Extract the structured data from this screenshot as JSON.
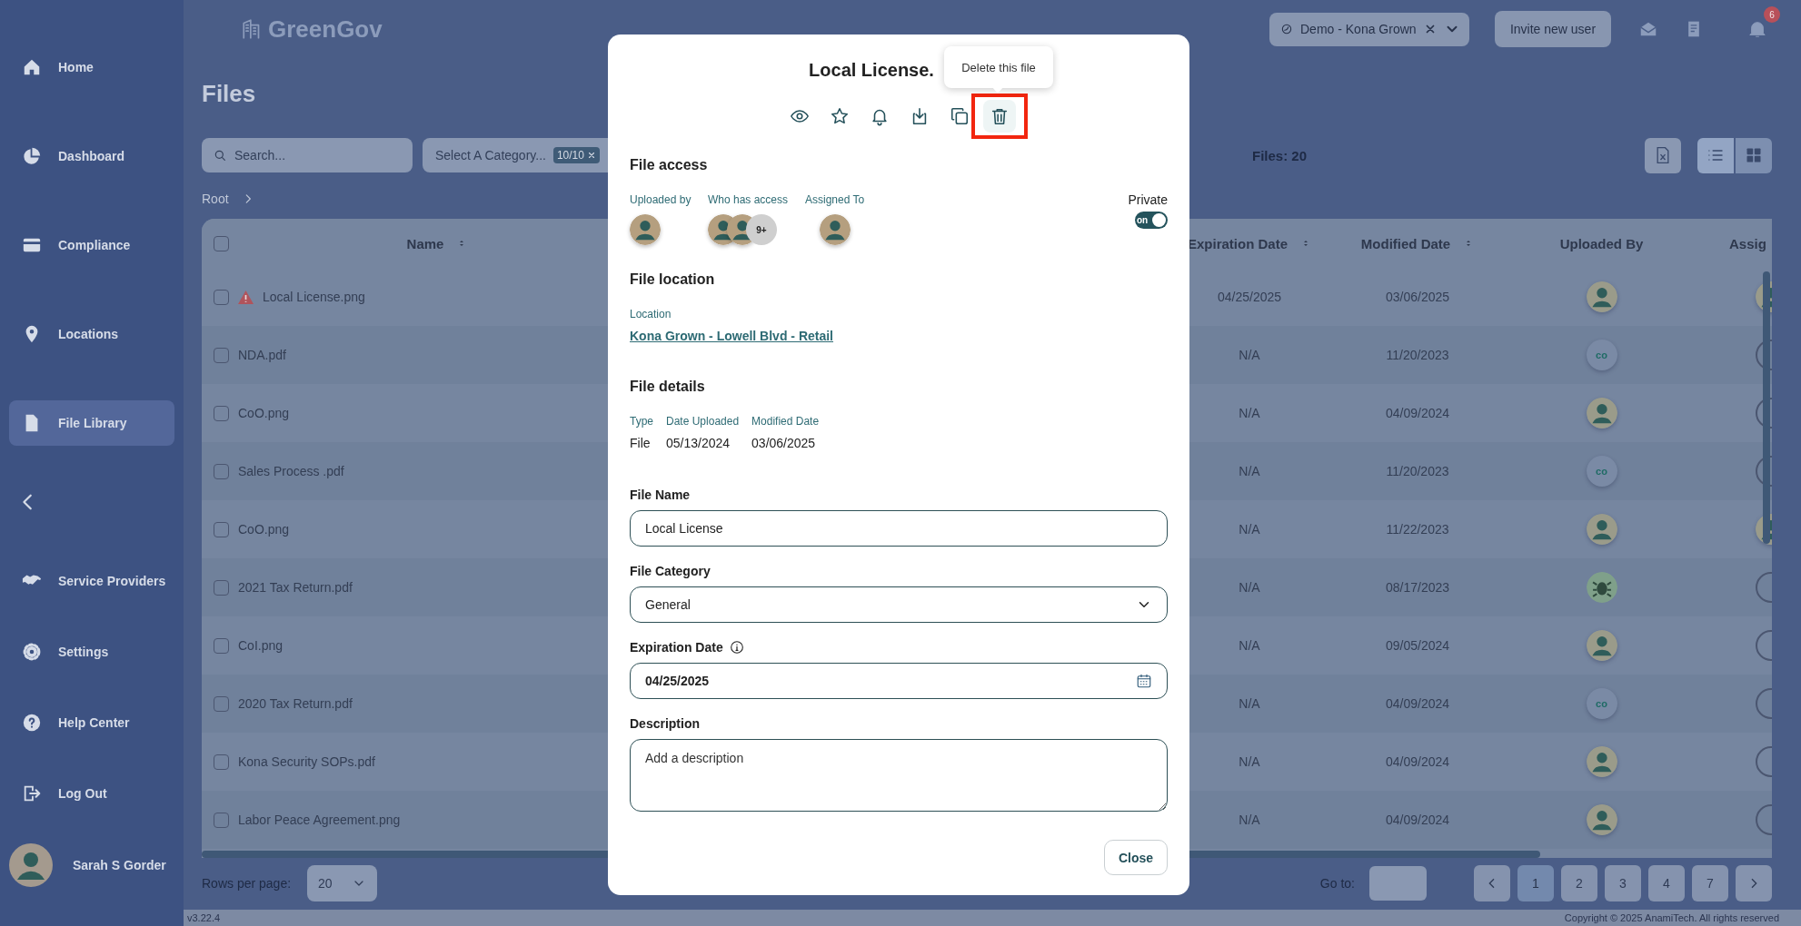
{
  "sidebar": {
    "items": [
      {
        "kind": "home",
        "label": "Home",
        "selected": false
      },
      {
        "kind": "dashboard",
        "label": "Dashboard",
        "selected": false
      },
      {
        "kind": "compliance",
        "label": "Compliance",
        "selected": false
      },
      {
        "kind": "locations",
        "label": "Locations",
        "selected": false
      },
      {
        "kind": "files",
        "label": "File Library",
        "selected": true
      }
    ],
    "bottom_items": [
      {
        "kind": "service",
        "label": "Service Providers",
        "selected": false
      },
      {
        "kind": "settings",
        "label": "Settings",
        "selected": false
      },
      {
        "kind": "help",
        "label": "Help Center",
        "selected": false
      },
      {
        "kind": "logout",
        "label": "Log Out",
        "selected": false
      }
    ],
    "user": {
      "name": "Sarah S Gorder"
    }
  },
  "topbar": {
    "logo": "GreenGov",
    "account": "Demo - Kona Grown",
    "invite_button": "Invite new user",
    "notification_badge": "6"
  },
  "page": {
    "title": "Files",
    "search": {
      "placeholder": "Search..."
    },
    "category_filter": {
      "placeholder": "Select A Category...",
      "chip": "10/10"
    },
    "file_count": "Files: 20",
    "views": [
      {
        "kind": "list",
        "selected": true
      },
      {
        "kind": "grid",
        "selected": false
      }
    ],
    "breadcrumb": [
      "Root"
    ]
  },
  "table": {
    "select_all": {
      "checked": false
    },
    "columns": [
      {
        "label": "Name",
        "sortable": true
      },
      {
        "label": "Expiration Date",
        "sortable": true
      },
      {
        "label": "Modified Date",
        "sortable": true
      },
      {
        "label": "Uploaded By",
        "sortable": false
      },
      {
        "label": "Assig",
        "sortable": false
      }
    ],
    "rows": [
      {
        "checked": false,
        "warning": true,
        "name": "Local License.png",
        "expiration": "04/25/2025",
        "modified": "03/06/2025",
        "uploaded_by": {
          "kind": "photo"
        },
        "assigned": {
          "kind": "photo"
        }
      },
      {
        "checked": false,
        "warning": false,
        "name": "NDA.pdf",
        "expiration": "N/A",
        "modified": "11/20/2023",
        "uploaded_by": {
          "kind": "initials",
          "text": "co"
        },
        "assigned": {
          "kind": "empty"
        }
      },
      {
        "checked": false,
        "warning": false,
        "name": "CoO.png",
        "expiration": "N/A",
        "modified": "04/09/2024",
        "uploaded_by": {
          "kind": "photo"
        },
        "assigned": {
          "kind": "empty"
        }
      },
      {
        "checked": false,
        "warning": false,
        "name": "Sales Process .pdf",
        "expiration": "N/A",
        "modified": "11/20/2023",
        "uploaded_by": {
          "kind": "initials",
          "text": "co"
        },
        "assigned": {
          "kind": "empty"
        }
      },
      {
        "checked": false,
        "warning": false,
        "name": "CoO.png",
        "expiration": "N/A",
        "modified": "11/22/2023",
        "uploaded_by": {
          "kind": "photo"
        },
        "assigned": {
          "kind": "photo"
        }
      },
      {
        "checked": false,
        "warning": false,
        "name": "2021 Tax Return.pdf",
        "expiration": "N/A",
        "modified": "08/17/2023",
        "uploaded_by": {
          "kind": "bug"
        },
        "assigned": {
          "kind": "empty"
        }
      },
      {
        "checked": false,
        "warning": false,
        "name": "CoI.png",
        "expiration": "N/A",
        "modified": "09/05/2024",
        "uploaded_by": {
          "kind": "photo"
        },
        "assigned": {
          "kind": "empty"
        }
      },
      {
        "checked": false,
        "warning": false,
        "name": "2020 Tax Return.pdf",
        "expiration": "N/A",
        "modified": "04/09/2024",
        "uploaded_by": {
          "kind": "initials",
          "text": "co"
        },
        "assigned": {
          "kind": "empty"
        }
      },
      {
        "checked": false,
        "warning": false,
        "name": "Kona Security SOPs.pdf",
        "expiration": "N/A",
        "modified": "04/09/2024",
        "uploaded_by": {
          "kind": "photo"
        },
        "assigned": {
          "kind": "empty"
        }
      },
      {
        "checked": false,
        "warning": false,
        "name": "Labor Peace Agreement.png",
        "expiration": "N/A",
        "modified": "04/09/2024",
        "uploaded_by": {
          "kind": "photo"
        },
        "assigned": {
          "kind": "empty"
        }
      }
    ]
  },
  "pagination": {
    "rows_per_page_label": "Rows per page:",
    "rows_per_page": "20",
    "goto_label": "Go to:",
    "pages": [
      {
        "label": "1",
        "selected": true
      },
      {
        "label": "2",
        "selected": false
      },
      {
        "label": "3",
        "selected": false
      },
      {
        "label": "4",
        "selected": false
      },
      {
        "label": "7",
        "selected": false
      }
    ]
  },
  "footer": {
    "version": "v3.22.4",
    "copyright": "Copyright © 2025 AnamiTech. All rights reserved"
  },
  "modal": {
    "title": "Local License.",
    "tooltip": "Delete this file",
    "actions": [
      {
        "kind": "view",
        "highlighted": false
      },
      {
        "kind": "favorite",
        "highlighted": false
      },
      {
        "kind": "notify",
        "highlighted": false
      },
      {
        "kind": "download",
        "highlighted": false
      },
      {
        "kind": "copy",
        "highlighted": false
      },
      {
        "kind": "delete",
        "highlighted": true
      }
    ],
    "access": {
      "heading": "File access",
      "uploaded_by": {
        "label": "Uploaded by",
        "avatars": [
          {
            "kind": "photo"
          }
        ]
      },
      "who_has_access": {
        "label": "Who has access",
        "avatars": [
          {
            "kind": "photo"
          },
          {
            "kind": "photo"
          }
        ],
        "more": "9+"
      },
      "assigned_to": {
        "label": "Assigned To",
        "avatars": [
          {
            "kind": "photo"
          }
        ]
      },
      "private": {
        "label": "Private",
        "on": true,
        "toggle_text": "on"
      }
    },
    "location": {
      "heading": "File location",
      "label": "Location",
      "link": "Kona Grown - Lowell Blvd - Retail"
    },
    "details": {
      "heading": "File details",
      "fields": [
        {
          "label": "Type",
          "value": "File"
        },
        {
          "label": "Date Uploaded",
          "value": "05/13/2024"
        },
        {
          "label": "Modified Date",
          "value": "03/06/2025"
        }
      ]
    },
    "form": {
      "file_name": {
        "label": "File Name",
        "value": "Local License"
      },
      "category": {
        "label": "File Category",
        "value": "General"
      },
      "expiration": {
        "label": "Expiration Date",
        "value": "04/25/2025"
      },
      "description": {
        "label": "Description",
        "placeholder": "Add a description"
      }
    },
    "close_button": "Close"
  }
}
